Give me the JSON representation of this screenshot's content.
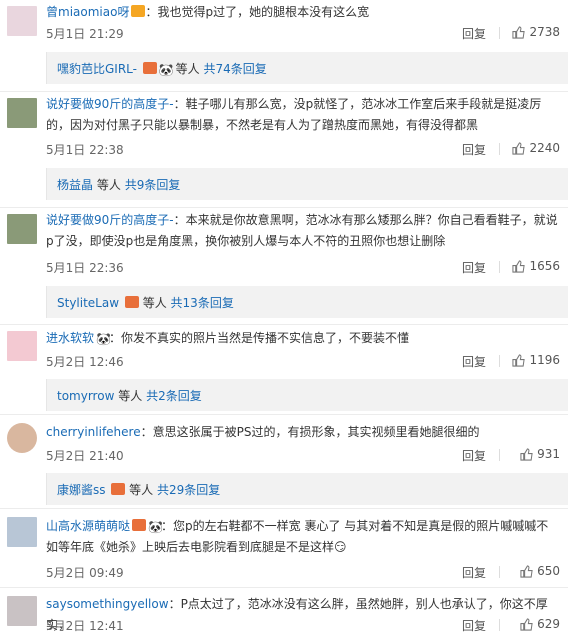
{
  "comments": [
    {
      "user": "曾miaomiao呀",
      "text": "：我也觉得p过了，她的腿根本没有这么宽",
      "date": "5月1日 21:29",
      "reply": "回复",
      "likes": "2738",
      "sub": {
        "names": "嘿豹芭比GIRL-",
        "others": "等人",
        "count": "共74条回复"
      }
    },
    {
      "user": "说好要做90斤的高度子-",
      "text": "：鞋子哪儿有那么宽，没p就怪了，范冰冰工作室后来手段就是挺凌厉的，因为对付黑子只能以暴制暴，不然老是有人为了蹭热度而黑她，有得没得都黑",
      "date": "5月1日 22:38",
      "reply": "回复",
      "likes": "2240",
      "sub": {
        "names": "杨益晶",
        "others": "等人",
        "count": "共9条回复"
      }
    },
    {
      "user": "说好要做90斤的高度子-",
      "text": "：本来就是你故意黑啊，范冰冰有那么矮那么胖？你自己看看鞋子，就说p了没，即使没p也是角度黑，换你被别人爆与本人不符的丑照你也想让删除",
      "date": "5月1日 22:36",
      "reply": "回复",
      "likes": "1656",
      "sub": {
        "names": "StyliteLaw",
        "others": "等人",
        "count": "共13条回复"
      }
    },
    {
      "user": "进水软软",
      "text": "：你发不真实的照片当然是传播不实信息了，不要装不懂",
      "date": "5月2日 12:46",
      "reply": "回复",
      "likes": "1196",
      "sub": {
        "names": "tomyrrow",
        "others": "等人",
        "count": "共2条回复"
      }
    },
    {
      "user": "cherryinlifehere",
      "text": "：意思这张属于被PS过的，有损形象，其实视频里看她腿很细的",
      "date": "5月2日 21:40",
      "reply": "回复",
      "likes": "931",
      "sub": {
        "names": "康娜酱ss",
        "others": "等人",
        "count": "共29条回复"
      }
    },
    {
      "user": "山高水源萌萌哒",
      "text": "：您p的左右鞋都不一样宽 裹心了 与其对着不知是真是假的照片嘁嘁嘁不如等年底《她杀》上映后去电影院看到底腿是不是这样😏",
      "date": "5月2日 09:49",
      "reply": "回复",
      "likes": "650"
    },
    {
      "user": "saysomethingyellow",
      "text": "：P点太过了，范冰冰没有这么胖，虽然她胖，别人也承认了，你这不厚实，",
      "date": "5月2日 12:41",
      "reply": "回复",
      "likes": "629"
    }
  ],
  "colors": {
    "link": "#1a6bb5",
    "subbox": "#f2f2f2"
  }
}
